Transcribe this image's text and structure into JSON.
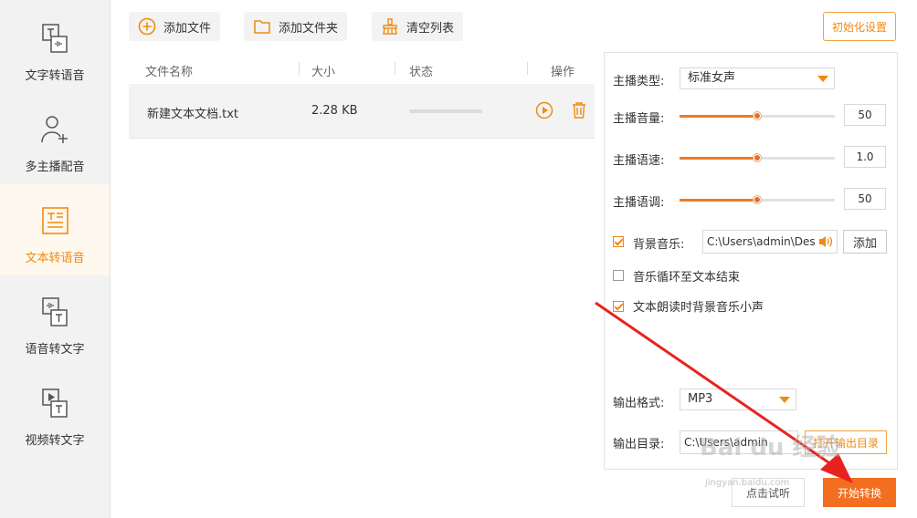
{
  "sidebar": {
    "items": [
      {
        "label": "文字转语音",
        "icon": "text-to-speech-icon",
        "active": false
      },
      {
        "label": "多主播配音",
        "icon": "user-add-icon",
        "active": false
      },
      {
        "label": "文本转语音",
        "icon": "document-text-icon",
        "active": true
      },
      {
        "label": "语音转文字",
        "icon": "speech-to-text-icon",
        "active": false
      },
      {
        "label": "视频转文字",
        "icon": "video-to-text-icon",
        "active": false
      }
    ]
  },
  "toolbar": {
    "add_file": "添加文件",
    "add_folder": "添加文件夹",
    "clear_list": "清空列表",
    "init_settings": "初始化设置"
  },
  "table": {
    "columns": [
      "文件名称",
      "大小",
      "状态",
      "操作"
    ],
    "rows": [
      {
        "name": "新建文本文档.txt",
        "size": "2.28 KB",
        "progress": 0
      }
    ]
  },
  "settings": {
    "anchor_type_label": "主播类型:",
    "anchor_type_value": "标准女声",
    "volume_label": "主播音量:",
    "volume_value": "50",
    "volume_fraction": 0.5,
    "speed_label": "主播语速:",
    "speed_value": "1.0",
    "speed_fraction": 0.5,
    "pitch_label": "主播语调:",
    "pitch_value": "50",
    "pitch_fraction": 0.5,
    "bg_music_label": "背景音乐:",
    "bg_music_checked": true,
    "bg_music_path": "C:\\Users\\admin\\Des",
    "add_label": "添加",
    "loop_label": "音乐循环至文本结束",
    "loop_checked": false,
    "duck_label": "文本朗读时背景音乐小声",
    "duck_checked": true,
    "output_format_label": "输出格式:",
    "output_format_value": "MP3",
    "output_dir_label": "输出目录:",
    "output_dir_path": "C:\\Users\\admin",
    "open_output_label": "打开输出目录"
  },
  "footer": {
    "preview_label": "点击试听",
    "start_label": "开始转换"
  },
  "watermark": {
    "main": "Bai du 经验",
    "sub": "jingyan.baidu.com"
  },
  "colors": {
    "accent": "#f08a12",
    "start_button": "#f36f1f",
    "arrow": "#e8231f"
  }
}
